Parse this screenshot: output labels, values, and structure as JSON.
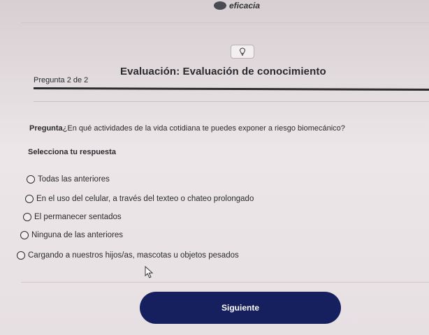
{
  "header": {
    "brand": "eficacia"
  },
  "evaluation": {
    "title": "Evaluación: Evaluación de conocimiento",
    "question_index": "Pregunta 2 de 2",
    "question_label": "Pregunta",
    "question_text": "¿En qué actividades de la vida cotidiana te puedes exponer a riesgo biomecánico?",
    "select_prompt": "Selecciona tu respuesta",
    "options": [
      "Todas las anteriores",
      "En el uso del celular, a través del texteo o chateo prolongado",
      "El permanecer sentados",
      "Ninguna de las anteriores",
      "Cargando a nuestros hijos/as, mascotas u objetos pesados"
    ]
  },
  "actions": {
    "next_label": "Siguiente"
  },
  "icons": {
    "hint": "lightbulb-icon",
    "pointer": "mouse-cursor-icon",
    "radio": "radio-icon"
  },
  "colors": {
    "primary_button": "#17205e",
    "text": "#2a2a2e"
  }
}
